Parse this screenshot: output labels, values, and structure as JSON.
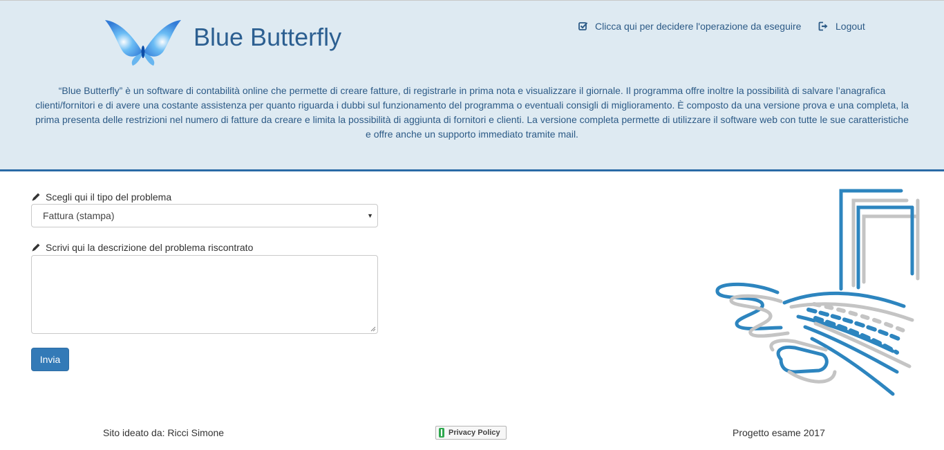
{
  "header": {
    "app_title": "Blue Butterfly",
    "nav_choose_operation": "Clicca qui per decidere l'operazione da eseguire",
    "nav_logout": "Logout",
    "description": "“Blue Butterfly” è un software di contabilità online che permette di creare fatture, di registrarle in prima nota e visualizzare il giornale. Il programma offre inoltre la possibilità di salvare l’anagrafica clienti/fornitori e di avere una costante assistenza per quanto riguarda i dubbi sul funzionamento del programma o eventuali consigli di miglioramento. È composto da una versione prova e una completa, la prima presenta delle restrizioni nel numero di fatture da creare e limita la possibilità di aggiunta di fornitori e clienti. La versione completa permette di utilizzare il software web con tutte le sue caratteristiche e offre anche un supporto immediato tramite mail."
  },
  "form": {
    "problem_type_label": "Scegli qui il tipo del problema",
    "problem_type_value": "Fattura (stampa)",
    "description_label": "Scrivi qui la descrizione del problema riscontrato",
    "description_value": "",
    "submit_label": "Invia"
  },
  "footer": {
    "author": "Sito ideato da: Ricci Simone",
    "privacy_label": "Privacy Policy",
    "project": "Progetto esame 2017"
  },
  "colors": {
    "header_bg": "#deeaf2",
    "accent": "#2a6aa6",
    "primary_button": "#337ab7"
  },
  "icons": [
    "butterfly-logo",
    "checkbox-icon",
    "logout-icon",
    "pencil-icon",
    "computer-illustration"
  ]
}
